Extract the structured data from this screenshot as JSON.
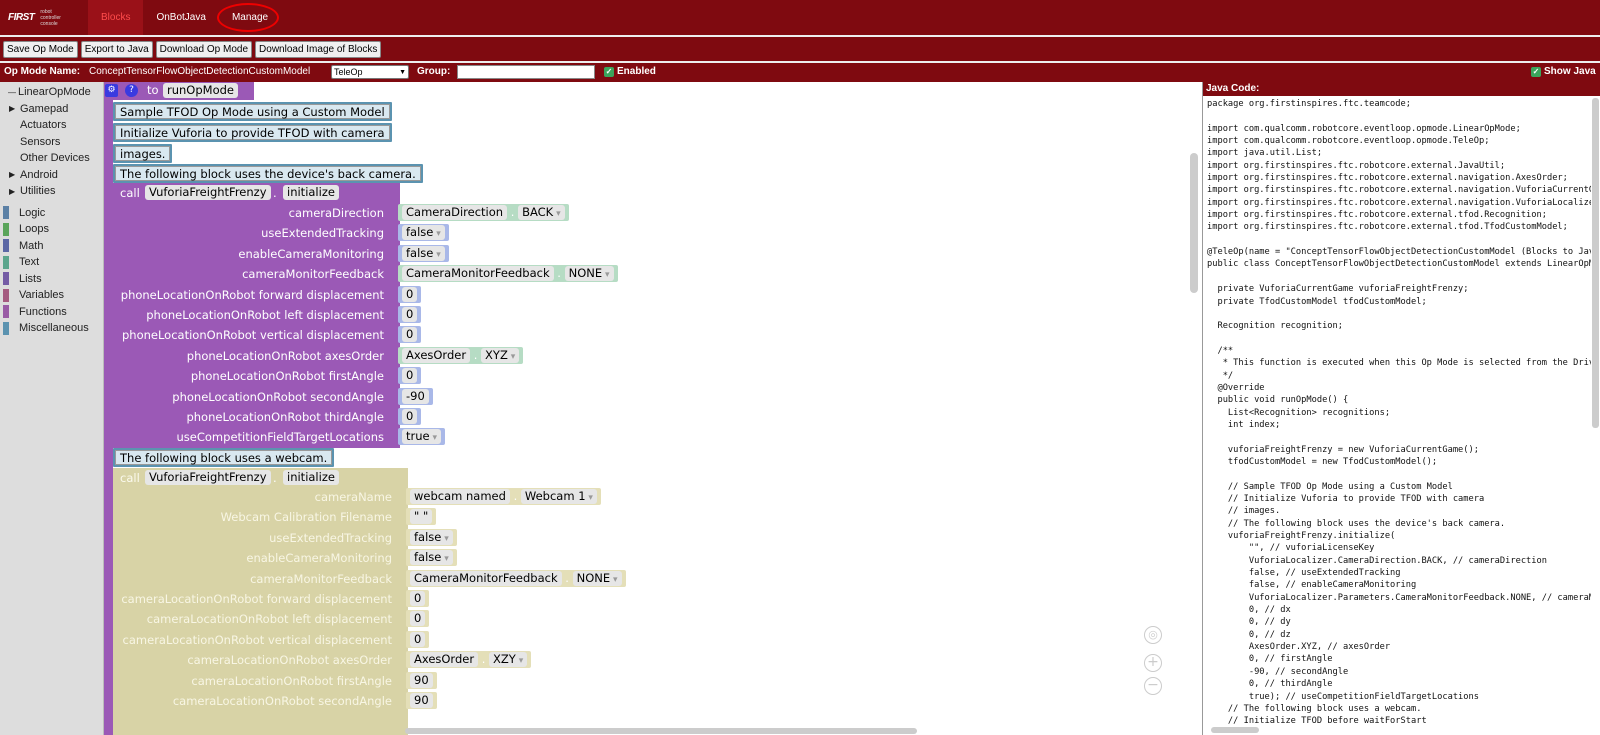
{
  "nav": {
    "logo_first": "FIRST",
    "logo_sub": "robot controller console",
    "items": [
      {
        "label": "Blocks"
      },
      {
        "label": "OnBotJava"
      },
      {
        "label": "Manage"
      }
    ]
  },
  "toolbar": {
    "save": "Save Op Mode",
    "export": "Export to Java",
    "download": "Download Op Mode",
    "download_image": "Download Image of Blocks"
  },
  "info": {
    "opmode_label": "Op Mode Name:",
    "opmode_name": "ConceptTensorFlowObjectDetectionCustomModel",
    "mode": "TeleOp",
    "group_label": "Group:",
    "enabled_label": "Enabled",
    "show_java_label": "Show Java"
  },
  "toolbox": {
    "items": [
      {
        "label": "LinearOpMode",
        "prefix": "—"
      },
      {
        "label": "Gamepad",
        "prefix": "▶"
      },
      {
        "label": "Actuators",
        "prefix": ""
      },
      {
        "label": "Sensors",
        "prefix": ""
      },
      {
        "label": "Other Devices",
        "prefix": ""
      },
      {
        "label": "Android",
        "prefix": "▶"
      },
      {
        "label": "Utilities",
        "prefix": "▶"
      },
      {
        "label": "Logic",
        "color": "#5b80a5"
      },
      {
        "label": "Loops",
        "color": "#5ba55b"
      },
      {
        "label": "Math",
        "color": "#5b67a5"
      },
      {
        "label": "Text",
        "color": "#5ba58c"
      },
      {
        "label": "Lists",
        "color": "#745ba5"
      },
      {
        "label": "Variables",
        "color": "#a55b80"
      },
      {
        "label": "Functions",
        "color": "#995ba5"
      },
      {
        "label": "Miscellaneous",
        "color": "#5b93b0"
      }
    ]
  },
  "blocks": {
    "to": "to",
    "fn": "runOpMode",
    "comments": [
      "Sample TFOD Op Mode using a Custom Model",
      "Initialize Vuforia to provide TFOD with camera",
      "images.",
      "The following block uses the device's back camera.",
      "The following block uses a webcam."
    ],
    "call": "call",
    "obj": "VuforiaFreightFrenzy",
    "method": "initialize",
    "params1": [
      {
        "label": "cameraDirection",
        "a": "CameraDirection",
        "b": "BACK"
      },
      {
        "label": "useExtendedTracking",
        "a": "false"
      },
      {
        "label": "enableCameraMonitoring",
        "a": "false"
      },
      {
        "label": "cameraMonitorFeedback",
        "a": "CameraMonitorFeedback",
        "b": "NONE"
      },
      {
        "label": "phoneLocationOnRobot forward displacement",
        "a": "0"
      },
      {
        "label": "phoneLocationOnRobot left displacement",
        "a": "0"
      },
      {
        "label": "phoneLocationOnRobot vertical displacement",
        "a": "0"
      },
      {
        "label": "phoneLocationOnRobot axesOrder",
        "a": "AxesOrder",
        "b": "XYZ"
      },
      {
        "label": "phoneLocationOnRobot firstAngle",
        "a": "0"
      },
      {
        "label": "phoneLocationOnRobot secondAngle",
        "a": "-90"
      },
      {
        "label": "phoneLocationOnRobot thirdAngle",
        "a": "0"
      },
      {
        "label": "useCompetitionFieldTargetLocations",
        "a": "true"
      }
    ],
    "params2": [
      {
        "label": "cameraName",
        "a": "webcam named",
        "b": "Webcam 1"
      },
      {
        "label": "Webcam Calibration Filename",
        "a": "\" \""
      },
      {
        "label": "useExtendedTracking",
        "a": "false"
      },
      {
        "label": "enableCameraMonitoring",
        "a": "false"
      },
      {
        "label": "cameraMonitorFeedback",
        "a": "CameraMonitorFeedback",
        "b": "NONE"
      },
      {
        "label": "cameraLocationOnRobot forward displacement",
        "a": "0"
      },
      {
        "label": "cameraLocationOnRobot left displacement",
        "a": "0"
      },
      {
        "label": "cameraLocationOnRobot vertical displacement",
        "a": "0"
      },
      {
        "label": "cameraLocationOnRobot axesOrder",
        "a": "AxesOrder",
        "b": "XZY"
      },
      {
        "label": "cameraLocationOnRobot firstAngle",
        "a": "90"
      },
      {
        "label": "cameraLocationOnRobot secondAngle",
        "a": "90"
      }
    ]
  },
  "java": {
    "header": "Java Code:",
    "lines": [
      "package org.firstinspires.ftc.teamcode;",
      "",
      "import com.qualcomm.robotcore.eventloop.opmode.LinearOpMode;",
      "import com.qualcomm.robotcore.eventloop.opmode.TeleOp;",
      "import java.util.List;",
      "import org.firstinspires.ftc.robotcore.external.JavaUtil;",
      "import org.firstinspires.ftc.robotcore.external.navigation.AxesOrder;",
      "import org.firstinspires.ftc.robotcore.external.navigation.VuforiaCurrentG",
      "import org.firstinspires.ftc.robotcore.external.navigation.VuforiaLocalize",
      "import org.firstinspires.ftc.robotcore.external.tfod.Recognition;",
      "import org.firstinspires.ftc.robotcore.external.tfod.TfodCustomModel;",
      "",
      "@TeleOp(name = \"ConceptTensorFlowObjectDetectionCustomModel (Blocks to Jav",
      "public class ConceptTensorFlowObjectDetectionCustomModel extends LinearOpM",
      "",
      "  private VuforiaCurrentGame vuforiaFreightFrenzy;",
      "  private TfodCustomModel tfodCustomModel;",
      "",
      "  Recognition recognition;",
      "",
      "  /**",
      "   * This function is executed when this Op Mode is selected from the Driv",
      "   */",
      "  @Override",
      "  public void runOpMode() {",
      "    List<Recognition> recognitions;",
      "    int index;",
      "",
      "    vuforiaFreightFrenzy = new VuforiaCurrentGame();",
      "    tfodCustomModel = new TfodCustomModel();",
      "",
      "    // Sample TFOD Op Mode using a Custom Model",
      "    // Initialize Vuforia to provide TFOD with camera",
      "    // images.",
      "    // The following block uses the device's back camera.",
      "    vuforiaFreightFrenzy.initialize(",
      "        \"\", // vuforiaLicenseKey",
      "        VuforiaLocalizer.CameraDirection.BACK, // cameraDirection",
      "        false, // useExtendedTracking",
      "        false, // enableCameraMonitoring",
      "        VuforiaLocalizer.Parameters.CameraMonitorFeedback.NONE, // cameraM",
      "        0, // dx",
      "        0, // dy",
      "        0, // dz",
      "        AxesOrder.XYZ, // axesOrder",
      "        0, // firstAngle",
      "        -90, // secondAngle",
      "        0, // thirdAngle",
      "        true); // useCompetitionFieldTargetLocations",
      "    // The following block uses a webcam.",
      "    // Initialize TFOD before waitForStart"
    ]
  }
}
